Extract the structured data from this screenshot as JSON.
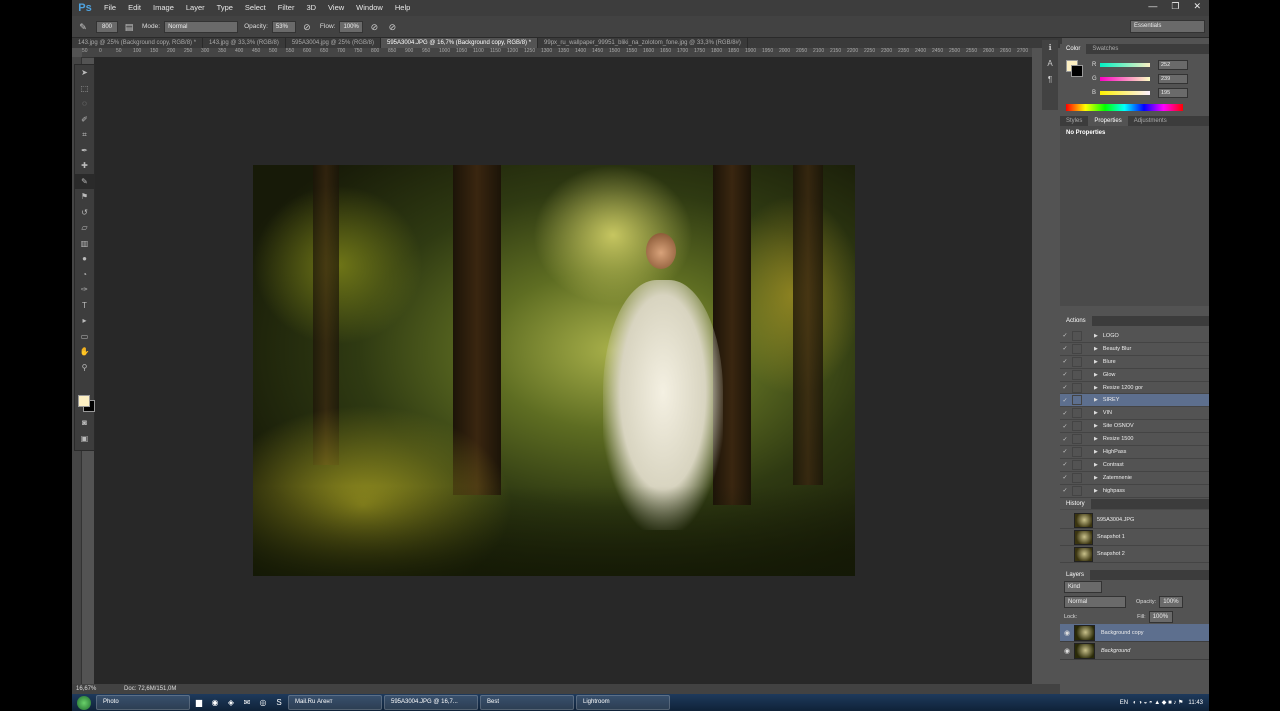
{
  "app": {
    "logo": "Ps",
    "menu": [
      "File",
      "Edit",
      "Image",
      "Layer",
      "Type",
      "Select",
      "Filter",
      "3D",
      "View",
      "Window",
      "Help"
    ],
    "window_controls": [
      "—",
      "❐",
      "✕"
    ]
  },
  "options_bar": {
    "brush_size": "800",
    "mode_label": "Mode:",
    "mode_value": "Normal",
    "opacity_label": "Opacity:",
    "opacity_value": "53%",
    "flow_label": "Flow:",
    "flow_value": "100%",
    "workspace": "Essentials"
  },
  "doc_tabs": [
    {
      "label": "143.jpg @ 25% (Background copy, RGB/8) *",
      "active": false
    },
    {
      "label": "143.jpg @ 33,3% (RGB/8)",
      "active": false
    },
    {
      "label": "595A3004.jpg @ 25% (RGB/8)",
      "active": false
    },
    {
      "label": "595A3004.JPG @ 16,7% (Background copy, RGB/8) *",
      "active": true
    },
    {
      "label": "99px_ru_wallpaper_99951_bliki_na_zolotom_fone.jpg @ 33,3% (RGB/8#)",
      "active": false
    }
  ],
  "ruler_ticks": [
    "50",
    "0",
    "50",
    "100",
    "150",
    "200",
    "250",
    "300",
    "350",
    "400",
    "450",
    "500",
    "550",
    "600",
    "650",
    "700",
    "750",
    "800",
    "850",
    "900",
    "950",
    "1000",
    "1050",
    "1100",
    "1150",
    "1200",
    "1250",
    "1300",
    "1350",
    "1400",
    "1450",
    "1500",
    "1550",
    "1600",
    "1650",
    "1700",
    "1750",
    "1800",
    "1850",
    "1900",
    "1950",
    "2000",
    "2050",
    "2100",
    "2150",
    "2200",
    "2250",
    "2300",
    "2350",
    "2400",
    "2450",
    "2500",
    "2550",
    "2600",
    "2650",
    "2700"
  ],
  "status": {
    "zoom": "16,67%",
    "doc": "Doc: 72,6M/151,0M"
  },
  "color_panel": {
    "tabs": [
      "Color",
      "Swatches"
    ],
    "r_label": "R",
    "r_value": "252",
    "g_label": "G",
    "g_value": "239",
    "b_label": "B",
    "b_value": "195",
    "fg_color": "#fcefc3"
  },
  "properties_panel": {
    "tabs": [
      "Styles",
      "Properties",
      "Adjustments"
    ],
    "text": "No Properties"
  },
  "actions_panel": {
    "title": "Actions",
    "items": [
      {
        "label": "LOGO",
        "selected": false
      },
      {
        "label": "Beauty Blur",
        "selected": false
      },
      {
        "label": "Blure",
        "selected": false
      },
      {
        "label": "Glow",
        "selected": false
      },
      {
        "label": "Resize 1200 gor",
        "selected": false
      },
      {
        "label": "SIREY",
        "selected": true
      },
      {
        "label": "VIN",
        "selected": false
      },
      {
        "label": "Site OSNOV",
        "selected": false
      },
      {
        "label": "Resize 1500",
        "selected": false
      },
      {
        "label": "HighPass",
        "selected": false
      },
      {
        "label": "Contrast",
        "selected": false
      },
      {
        "label": "Zatemnenie",
        "selected": false
      },
      {
        "label": "highpass",
        "selected": false
      }
    ]
  },
  "history_panel": {
    "title": "History",
    "items": [
      "595A3004.JPG",
      "Snapshot 1",
      "Snapshot 2"
    ]
  },
  "layers_panel": {
    "title": "Layers",
    "kind": "Kind",
    "blend": "Normal",
    "opacity_label": "Opacity:",
    "opacity_value": "100%",
    "lock_label": "Lock:",
    "fill_label": "Fill:",
    "fill_value": "100%",
    "layers": [
      {
        "name": "Background copy",
        "selected": true
      },
      {
        "name": "Background",
        "selected": false
      }
    ]
  },
  "taskbar": {
    "buttons": [
      "Photo",
      "Mail.Ru Агент",
      "595A3004.JPG @ 16,7...",
      "Best",
      "Lightroom"
    ],
    "lang": "EN",
    "clock": "11:43"
  }
}
